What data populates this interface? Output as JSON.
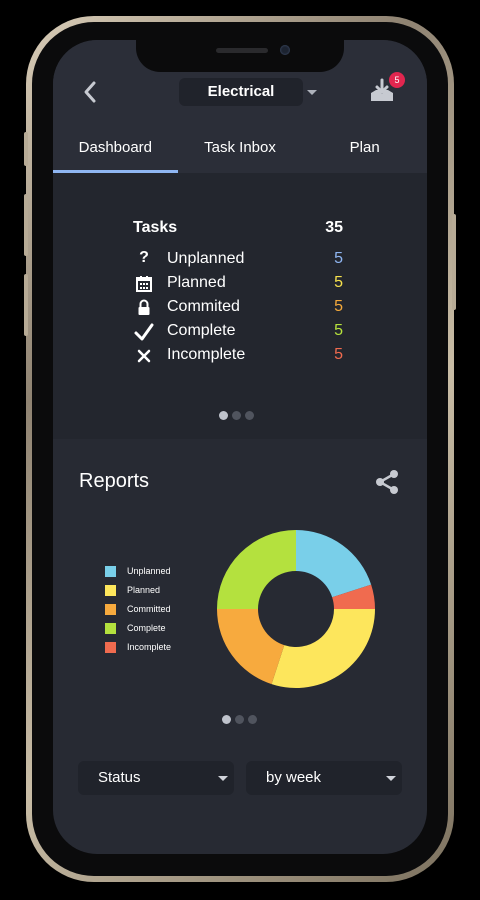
{
  "header": {
    "title": "Electrical",
    "notification_count": "5"
  },
  "tabs": [
    {
      "label": "Dashboard",
      "active": true
    },
    {
      "label": "Task Inbox",
      "active": false
    },
    {
      "label": "Plan",
      "active": false
    }
  ],
  "tasks": {
    "heading": "Tasks",
    "total": "35",
    "rows": [
      {
        "icon": "question-icon",
        "label": "Unplanned",
        "value": "5",
        "color": "#8fb6f2"
      },
      {
        "icon": "calendar-icon",
        "label": "Planned",
        "value": "5",
        "color": "#f5e04d"
      },
      {
        "icon": "lock-icon",
        "label": "Commited",
        "value": "5",
        "color": "#f4a93b"
      },
      {
        "icon": "check-icon",
        "label": "Complete",
        "value": "5",
        "color": "#b6e23c"
      },
      {
        "icon": "close-icon",
        "label": "Incomplete",
        "value": "5",
        "color": "#f06b4f"
      }
    ],
    "pager": {
      "count": 3,
      "active": 0
    }
  },
  "reports": {
    "title": "Reports",
    "pager": {
      "count": 3,
      "active": 0
    }
  },
  "chart_data": {
    "type": "pie",
    "donut": true,
    "legend_position": "left",
    "categories": [
      "Unplanned",
      "Planned",
      "Committed",
      "Complete",
      "Incomplete"
    ],
    "values": [
      20,
      30,
      20,
      25,
      5
    ],
    "colors": [
      "#79cfe9",
      "#fde65c",
      "#f7aa3e",
      "#b4e13e",
      "#f06b4f"
    ],
    "slice_order": [
      "Unplanned",
      "Incomplete",
      "Planned",
      "Committed",
      "Complete"
    ]
  },
  "filters": {
    "status_label": "Status",
    "period_label": "by week"
  }
}
